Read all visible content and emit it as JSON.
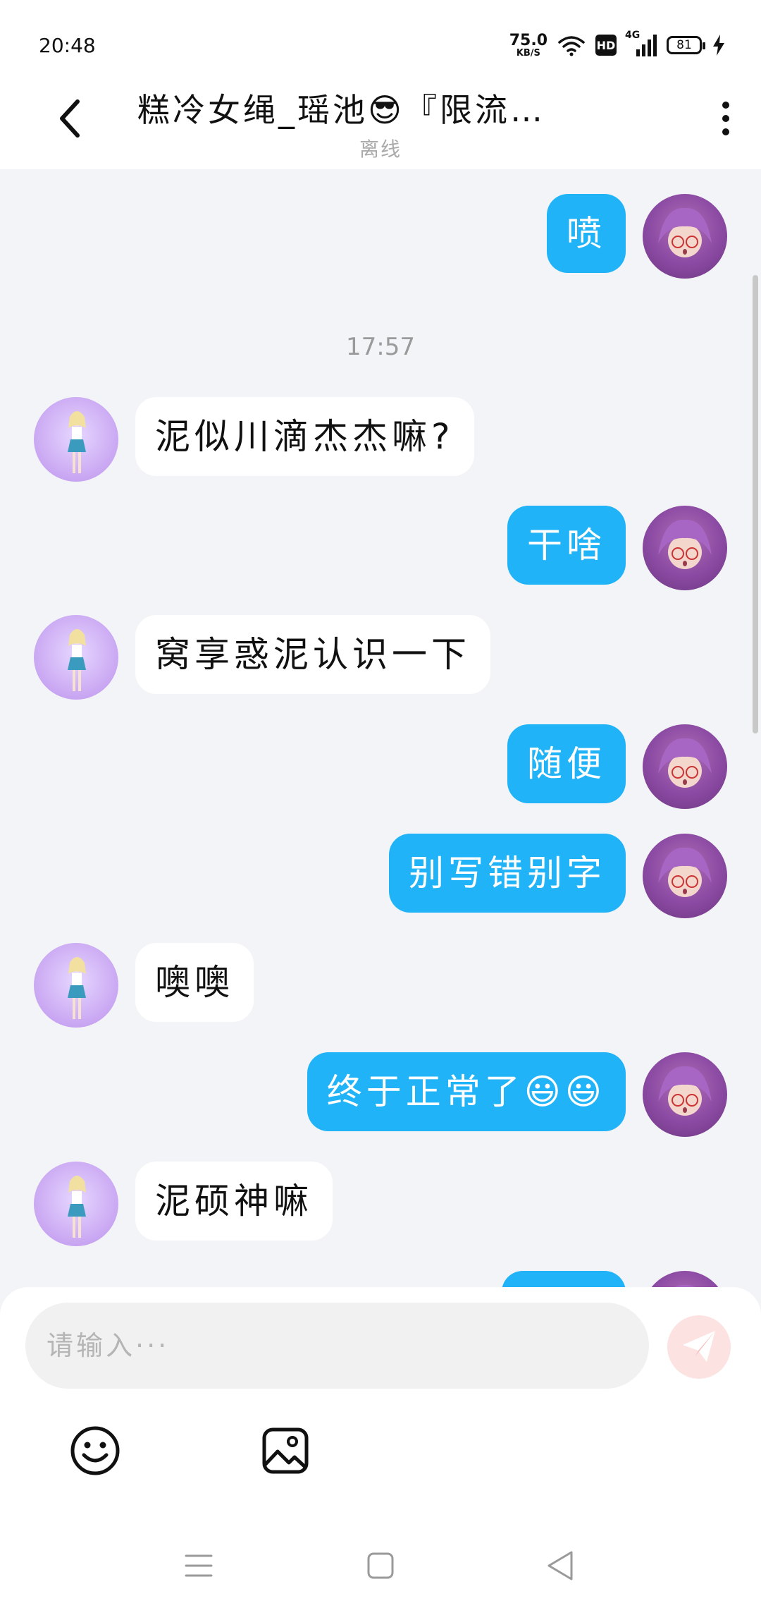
{
  "status_bar": {
    "time": "20:48",
    "net_speed": "75.0",
    "net_unit": "KB/S",
    "hd_badge": "HD",
    "network_type": "4G",
    "battery_level": "81"
  },
  "header": {
    "title": "糕冷女绳_瑶池😎『限流…",
    "status": "离线"
  },
  "messages": [
    {
      "sender": "me",
      "text": "喷"
    },
    {
      "type": "timestamp",
      "text": "17:57"
    },
    {
      "sender": "other",
      "text": "泥似川滴杰杰嘛?"
    },
    {
      "sender": "me",
      "text": "干啥"
    },
    {
      "sender": "other",
      "text": "窝享惑泥认识一下"
    },
    {
      "sender": "me",
      "text": "随便"
    },
    {
      "sender": "me",
      "text": "别写错别字"
    },
    {
      "sender": "other",
      "text": "噢噢"
    },
    {
      "sender": "me",
      "text": "终于正常了😃😃"
    },
    {
      "sender": "other",
      "text": "泥硕神嘛"
    }
  ],
  "input": {
    "placeholder": "请输入···"
  },
  "icons": {
    "back": "back-arrow-icon",
    "more": "more-vertical-icon",
    "send": "send-paper-plane-icon",
    "emoji": "emoji-smiley-icon",
    "image": "image-picker-icon",
    "nav_menu": "nav-menu-icon",
    "nav_home": "nav-home-icon",
    "nav_back": "nav-back-icon"
  },
  "colors": {
    "my_bubble": "#21b3f7",
    "other_bubble": "#ffffff",
    "background": "#f3f4f7",
    "send_button": "#fde2e2"
  }
}
